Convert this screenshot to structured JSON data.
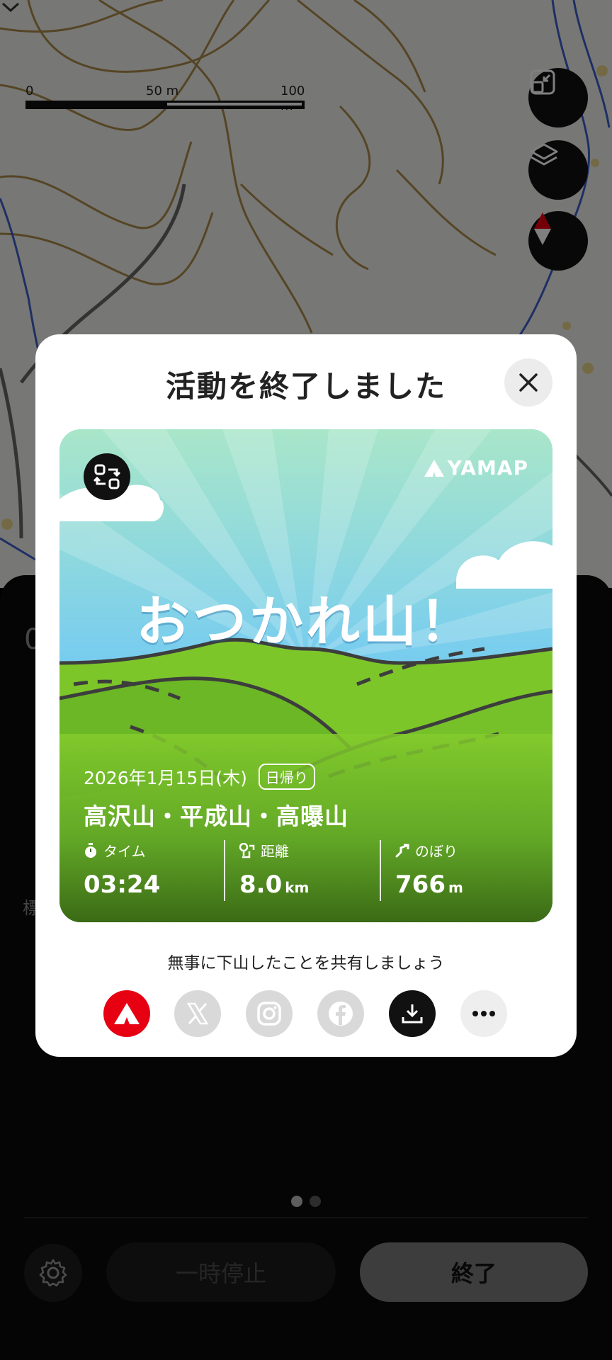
{
  "map": {
    "scale_labels": [
      "0",
      "50 m",
      "100 m"
    ],
    "buttons": [
      "fullscreen-toggle-icon",
      "layers-icon",
      "compass-icon"
    ]
  },
  "sheet": {
    "partial_number": "0",
    "partial_side_label": "標"
  },
  "modal": {
    "title": "活動を終了しました",
    "card": {
      "brand": "YAMAP",
      "headline": "おつかれ山！",
      "date": "2026年1月15日(木)",
      "trip_type": "日帰り",
      "mountains": "高沢山・平成山・高曝山",
      "stats": [
        {
          "label": "タイム",
          "value": "03:24",
          "unit": "",
          "icon": "stopwatch-icon"
        },
        {
          "label": "距離",
          "value": "8.0",
          "unit": "km",
          "icon": "distance-pin-icon"
        },
        {
          "label": "のぼり",
          "value": "766",
          "unit": "m",
          "icon": "ascent-icon"
        }
      ]
    },
    "share_text": "無事に下山したことを共有しましょう",
    "share_targets": [
      "yamap",
      "x",
      "instagram",
      "facebook",
      "download",
      "more"
    ]
  },
  "pager": {
    "count": 2,
    "active": 0
  },
  "controls": {
    "pause_label": "一時停止",
    "end_label": "終了"
  },
  "colors": {
    "yamap_red": "#e60012",
    "card_sky": "#7ecff0",
    "card_grass": "#7cc62a",
    "end_button": "#7a7a7a"
  }
}
